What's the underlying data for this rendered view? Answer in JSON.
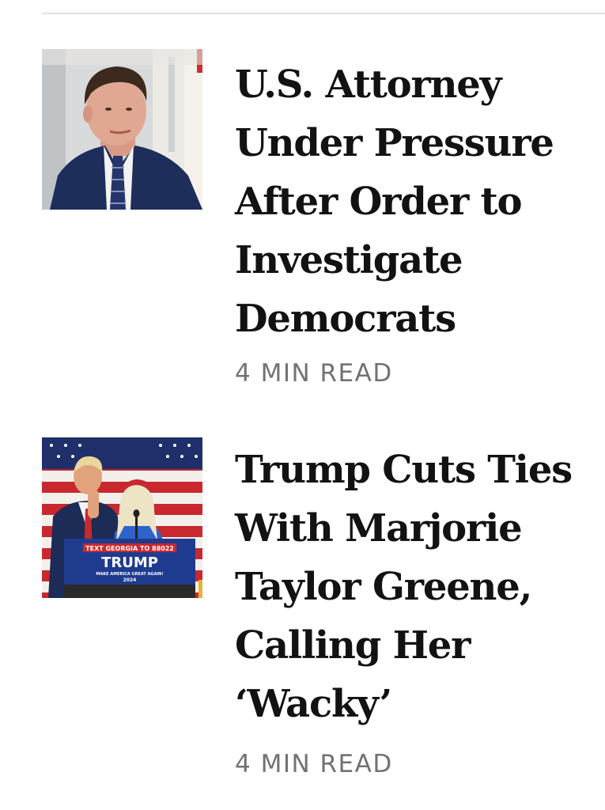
{
  "stories": [
    {
      "headline": "U.S. Attorney\nUnder Pressure\nAfter Order to\nInvestigate\nDemocrats",
      "read_time": "4 MIN READ"
    },
    {
      "headline": "Trump Cuts Ties\nWith Marjorie\nTaylor Greene,\nCalling Her\n‘Wacky’",
      "read_time": "4 MIN READ",
      "photo_sign": {
        "line1": "TEXT GEORGIA TO 88022",
        "line2": "TRUMP",
        "line3": "MAKE AMERICA GREAT AGAIN!",
        "line4": "2024"
      }
    }
  ]
}
